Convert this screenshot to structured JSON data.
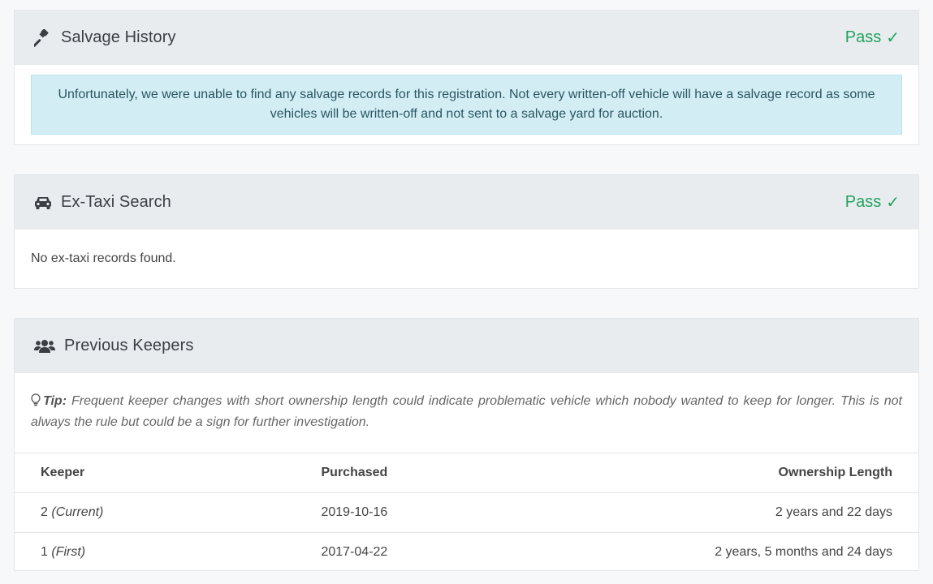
{
  "salvage": {
    "title": "Salvage History",
    "status": "Pass",
    "check": "✓",
    "message": "Unfortunately, we were unable to find any salvage records for this registration. Not every written-off vehicle will have a salvage record as some vehicles will be written-off and not sent to a salvage yard for auction."
  },
  "taxi": {
    "title": "Ex-Taxi Search",
    "status": "Pass",
    "check": "✓",
    "message": "No ex-taxi records found."
  },
  "keepers": {
    "title": "Previous Keepers",
    "tip_label": "Tip:",
    "tip_text": " Frequent keeper changes with short ownership length could indicate problematic vehicle which nobody wanted to keep for longer. This is not always the rule but could be a sign for further investigation.",
    "columns": [
      "Keeper",
      "Purchased",
      "Ownership Length"
    ],
    "rows": [
      {
        "keeper": "2",
        "note": "(Current)",
        "purchased": "2019-10-16",
        "length": "2 years and 22 days"
      },
      {
        "keeper": "1",
        "note": "(First)",
        "purchased": "2017-04-22",
        "length": "2 years, 5 months and 24 days"
      }
    ]
  },
  "colors": {
    "pass": "#21a35f",
    "header_bg": "#e9ecef",
    "alert_bg": "#d2eef4"
  }
}
